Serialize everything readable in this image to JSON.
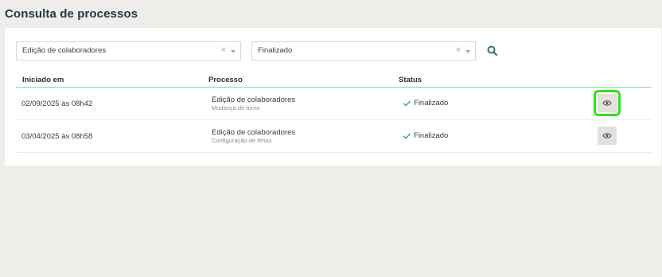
{
  "page": {
    "title": "Consulta de processos"
  },
  "filters": {
    "process_select": {
      "value": "Edição de colaboradores",
      "clear_symbol": "×"
    },
    "status_select": {
      "value": "Finalizado",
      "clear_symbol": "×"
    },
    "search_icon": "search-icon"
  },
  "table": {
    "columns": [
      "Iniciado em",
      "Processo",
      "Status"
    ],
    "rows": [
      {
        "started_at": "02/09/2025 às 08h42",
        "process": "Edição de colaboradores",
        "subprocess": "Mudança de turno",
        "status": "Finalizado",
        "focused": true
      },
      {
        "started_at": "03/04/2025 às 08h58",
        "process": "Edição de colaboradores",
        "subprocess": "Configuração de férias",
        "status": "Finalizado",
        "focused": false
      }
    ]
  },
  "colors": {
    "accent": "#2e7d4f",
    "focus_highlight": "#35e11a"
  }
}
